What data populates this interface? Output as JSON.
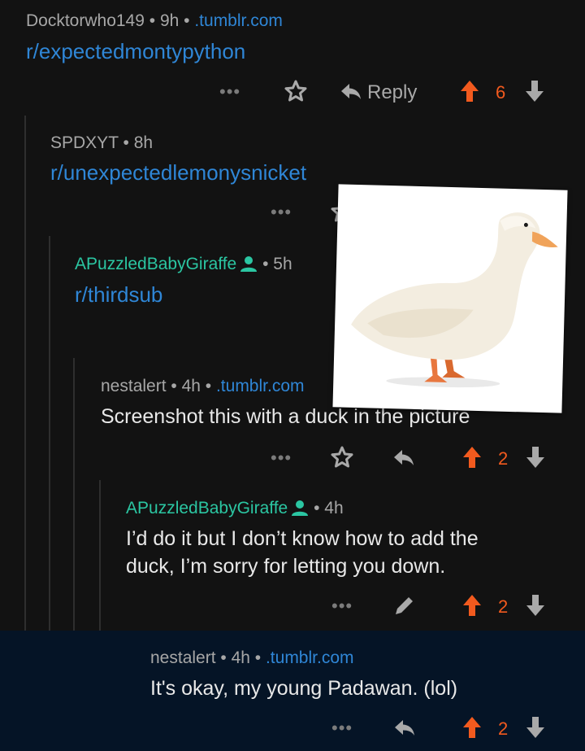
{
  "comments": [
    {
      "meta": {
        "user": "Docktorwho149",
        "sep1": " • ",
        "time": "9h",
        "sep2": " • ",
        "domain": ".tumblr.com"
      },
      "subreddit": "r/expectedmontypython",
      "actions": {
        "more": "•••",
        "reply": "Reply",
        "score": "6"
      }
    },
    {
      "meta": {
        "user": "SPDXYT",
        "sep1": " • ",
        "time": "8h"
      },
      "subreddit": "r/unexpectedlemonysnicket",
      "actions": {
        "more": "•••"
      }
    },
    {
      "meta": {
        "user": "APuzzledBabyGiraffe",
        "sep1": " • ",
        "time": "5h"
      },
      "subreddit": "r/thirdsub"
    },
    {
      "meta": {
        "user": "nestalert",
        "sep1": " • ",
        "time": "4h",
        "sep2": " • ",
        "domain": ".tumblr.com"
      },
      "text": "Screenshot this with a duck in the picture",
      "actions": {
        "more": "•••",
        "score": "2"
      }
    },
    {
      "meta": {
        "user": "APuzzledBabyGiraffe",
        "sep1": " • ",
        "time": "4h"
      },
      "text_line1": "I’d do it but I don’t know how to add the",
      "text_line2": "duck, I’m sorry for letting you down.",
      "actions": {
        "more": "•••",
        "score": "2"
      }
    },
    {
      "meta": {
        "user": "nestalert",
        "sep1": " • ",
        "time": "4h",
        "sep2": " • ",
        "domain": ".tumblr.com"
      },
      "text": "It's okay, my young Padawan. (lol)",
      "actions": {
        "more": "•••",
        "score": "2"
      }
    }
  ],
  "colors": {
    "background": "#121212",
    "link": "#2f86d6",
    "op_username": "#2bc6a2",
    "upvote": "#f25a1e",
    "highlight": "#051426"
  },
  "overlay": {
    "image": "white-duck-photo"
  }
}
